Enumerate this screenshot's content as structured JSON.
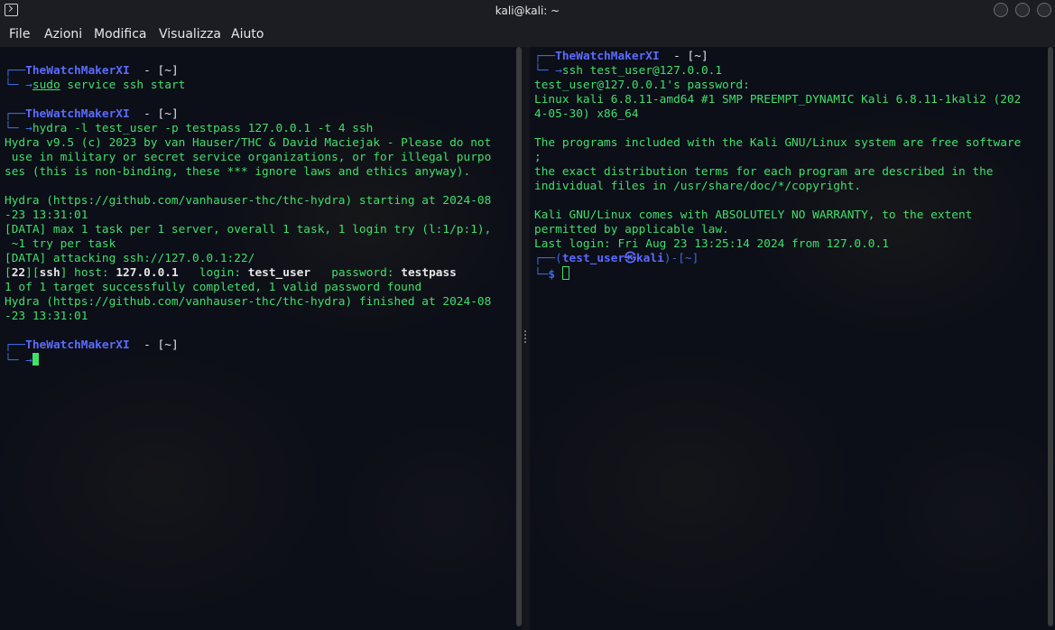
{
  "window": {
    "title": "kali@kali: ~"
  },
  "menu": [
    "File",
    "Azioni",
    "Modifica",
    "Visualizza",
    "Aiuto"
  ],
  "prompt": {
    "box_top": "┌──",
    "box_bottom": "└─",
    "arrow": "→",
    "user": "TheWatchMakerXI",
    "dir": "- [~]"
  },
  "left": {
    "cmd1_sudo": "sudo",
    "cmd1_rest": " service ssh start",
    "cmd2": "hydra -l test_user -p testpass 127.0.0.1 -t 4 ssh",
    "out": [
      "Hydra v9.5 (c) 2023 by van Hauser/THC & David Maciejak - Please do not",
      " use in military or secret service organizations, or for illegal purpo",
      "ses (this is non-binding, these *** ignore laws and ethics anyway).",
      "",
      "Hydra (https://github.com/vanhauser-thc/thc-hydra) starting at 2024-08",
      "-23 13:31:01",
      "[DATA] max 1 task per 1 server, overall 1 task, 1 login try (l:1/p:1),",
      " ~1 try per task",
      "[DATA] attacking ssh://127.0.0.1:22/"
    ],
    "result": {
      "port": "22",
      "service": "ssh",
      "host_label": " host: ",
      "host": "127.0.0.1",
      "login_label": "   login: ",
      "login": "test_user",
      "password_label": "   password: ",
      "password": "testpass"
    },
    "out2": [
      "1 of 1 target successfully completed, 1 valid password found",
      "Hydra (https://github.com/vanhauser-thc/thc-hydra) finished at 2024-08",
      "-23 13:31:01"
    ]
  },
  "right": {
    "cmd": "ssh test_user@127.0.0.1",
    "out": [
      "test_user@127.0.0.1's password:",
      "Linux kali 6.8.11-amd64 #1 SMP PREEMPT_DYNAMIC Kali 6.8.11-1kali2 (202",
      "4-05-30) x86_64",
      "",
      "The programs included with the Kali GNU/Linux system are free software",
      ";",
      "the exact distribution terms for each program are described in the",
      "individual files in /usr/share/doc/*/copyright.",
      "",
      "Kali GNU/Linux comes with ABSOLUTELY NO WARRANTY, to the extent",
      "permitted by applicable law.",
      "Last login: Fri Aug 23 13:25:14 2024 from 127.0.0.1"
    ],
    "prompt2": {
      "open": "┌──(",
      "user": "test_user",
      "at": "㉿",
      "host": "kali",
      "close": ")-[~]",
      "bottom": "└─",
      "dollar": "$"
    }
  }
}
